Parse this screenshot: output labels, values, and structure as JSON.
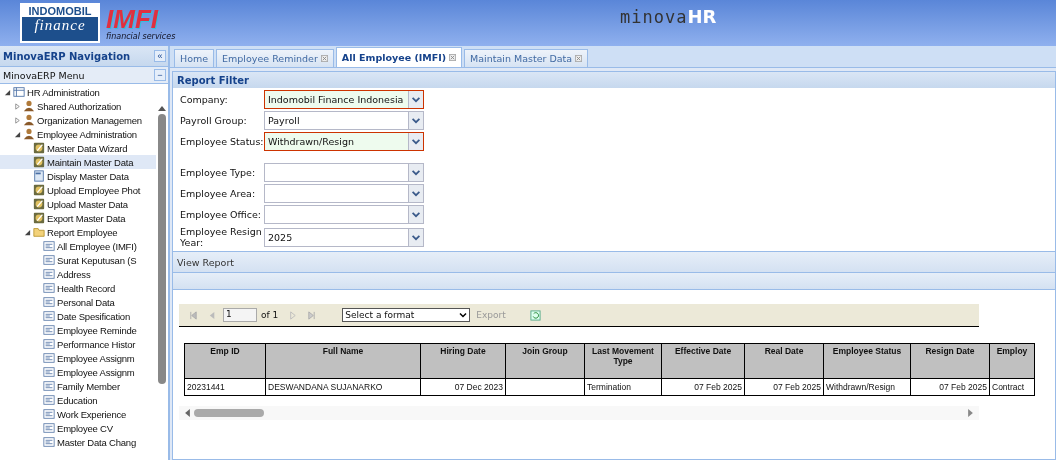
{
  "header": {
    "logo_top": "INDOMOBIL",
    "logo_bottom": "finance",
    "brand": "IMFI",
    "brand_sub": "financial services",
    "app_name": "minova",
    "app_suffix": "HR"
  },
  "sidebar": {
    "title": "MinovaERP Navigation",
    "collapse": "«",
    "menu_title": "MinovaERP Menu",
    "menu_toggle": "−",
    "tree": [
      {
        "label": "HR Administration",
        "kind": "grid",
        "expanded": true,
        "selected": false,
        "children": [
          {
            "label": "Shared Authorization",
            "kind": "person",
            "expanded": false,
            "selected": false
          },
          {
            "label": "Organization Managemen",
            "kind": "person",
            "expanded": false,
            "selected": false
          },
          {
            "label": "Employee Administration",
            "kind": "person",
            "expanded": true,
            "selected": false,
            "children": [
              {
                "label": "Master Data Wizard",
                "kind": "pad",
                "selected": false
              },
              {
                "label": "Maintain Master Data",
                "kind": "pad",
                "selected": true
              },
              {
                "label": "Display Master Data",
                "kind": "page",
                "selected": false
              },
              {
                "label": "Upload Employee Phot",
                "kind": "pad",
                "selected": false
              },
              {
                "label": "Upload Master Data",
                "kind": "pad",
                "selected": false
              },
              {
                "label": "Export Master Data",
                "kind": "pad",
                "selected": false
              },
              {
                "label": "Report Employee",
                "kind": "folder",
                "expanded": true,
                "selected": false,
                "children": [
                  {
                    "label": "All Employee (IMFI)",
                    "kind": "report",
                    "selected": false
                  },
                  {
                    "label": "Surat Keputusan (S",
                    "kind": "report",
                    "selected": false
                  },
                  {
                    "label": "Address",
                    "kind": "report",
                    "selected": false
                  },
                  {
                    "label": "Health Record",
                    "kind": "report",
                    "selected": false
                  },
                  {
                    "label": "Personal Data",
                    "kind": "report",
                    "selected": false
                  },
                  {
                    "label": "Date Spesification",
                    "kind": "report",
                    "selected": false
                  },
                  {
                    "label": "Employee Reminde",
                    "kind": "report",
                    "selected": false
                  },
                  {
                    "label": "Performance Histor",
                    "kind": "report",
                    "selected": false
                  },
                  {
                    "label": "Employee Assignm",
                    "kind": "report",
                    "selected": false
                  },
                  {
                    "label": "Employee Assignm",
                    "kind": "report",
                    "selected": false
                  },
                  {
                    "label": "Family Member",
                    "kind": "report",
                    "selected": false
                  },
                  {
                    "label": "Education",
                    "kind": "report",
                    "selected": false
                  },
                  {
                    "label": "Work Experience",
                    "kind": "report",
                    "selected": false
                  },
                  {
                    "label": "Employee CV",
                    "kind": "report",
                    "selected": false
                  },
                  {
                    "label": "Master Data Chang",
                    "kind": "report",
                    "selected": false
                  }
                ]
              }
            ]
          }
        ]
      }
    ]
  },
  "tabs": [
    {
      "label": "Home",
      "closable": false,
      "selected": false
    },
    {
      "label": "Employee Reminder",
      "closable": true,
      "selected": false
    },
    {
      "label": "All Employee (IMFI)",
      "closable": true,
      "selected": true
    },
    {
      "label": "Maintain Master Data",
      "closable": true,
      "selected": false
    }
  ],
  "filter": {
    "title": "Report Filter",
    "fields": [
      {
        "label": "Company:",
        "value": "Indomobil Finance Indonesia",
        "highlighted": true
      },
      {
        "label": "Payroll Group:",
        "value": "Payroll",
        "highlighted": false
      },
      {
        "label": "Employee Status:",
        "value": "Withdrawn/Resign",
        "highlighted": true
      },
      {
        "label": "Employee Type:",
        "highlighted": false
      },
      {
        "label": "Employee Area:",
        "highlighted": false
      },
      {
        "label": "Employee Office:",
        "highlighted": false
      },
      {
        "label": "Employee Resign Year:",
        "value": "2025",
        "highlighted": false
      }
    ],
    "view_report": "View Report"
  },
  "report": {
    "page": "1",
    "of": "of 1",
    "format": "Select a format",
    "export": "Export",
    "columns": [
      {
        "label": "Emp ID",
        "kind": "text"
      },
      {
        "label": "Full Name",
        "kind": "text"
      },
      {
        "label": "Hiring Date",
        "kind": "date"
      },
      {
        "label": "Join Group",
        "kind": "text"
      },
      {
        "label": "Last Movement Type",
        "kind": "text"
      },
      {
        "label": "Effective Date",
        "kind": "date"
      },
      {
        "label": "Real Date",
        "kind": "date"
      },
      {
        "label": "Employee Status",
        "kind": "text"
      },
      {
        "label": "Resign Date",
        "kind": "date"
      },
      {
        "label": "Employ",
        "kind": "text"
      }
    ],
    "rows": [
      [
        "20231441",
        "DESWANDANA SUJANARKO",
        "07 Dec 2023",
        "",
        "Termination",
        "07 Feb 2025",
        "07 Feb 2025",
        "Withdrawn/Resign",
        "07 Feb 2025",
        "Contract"
      ]
    ]
  }
}
